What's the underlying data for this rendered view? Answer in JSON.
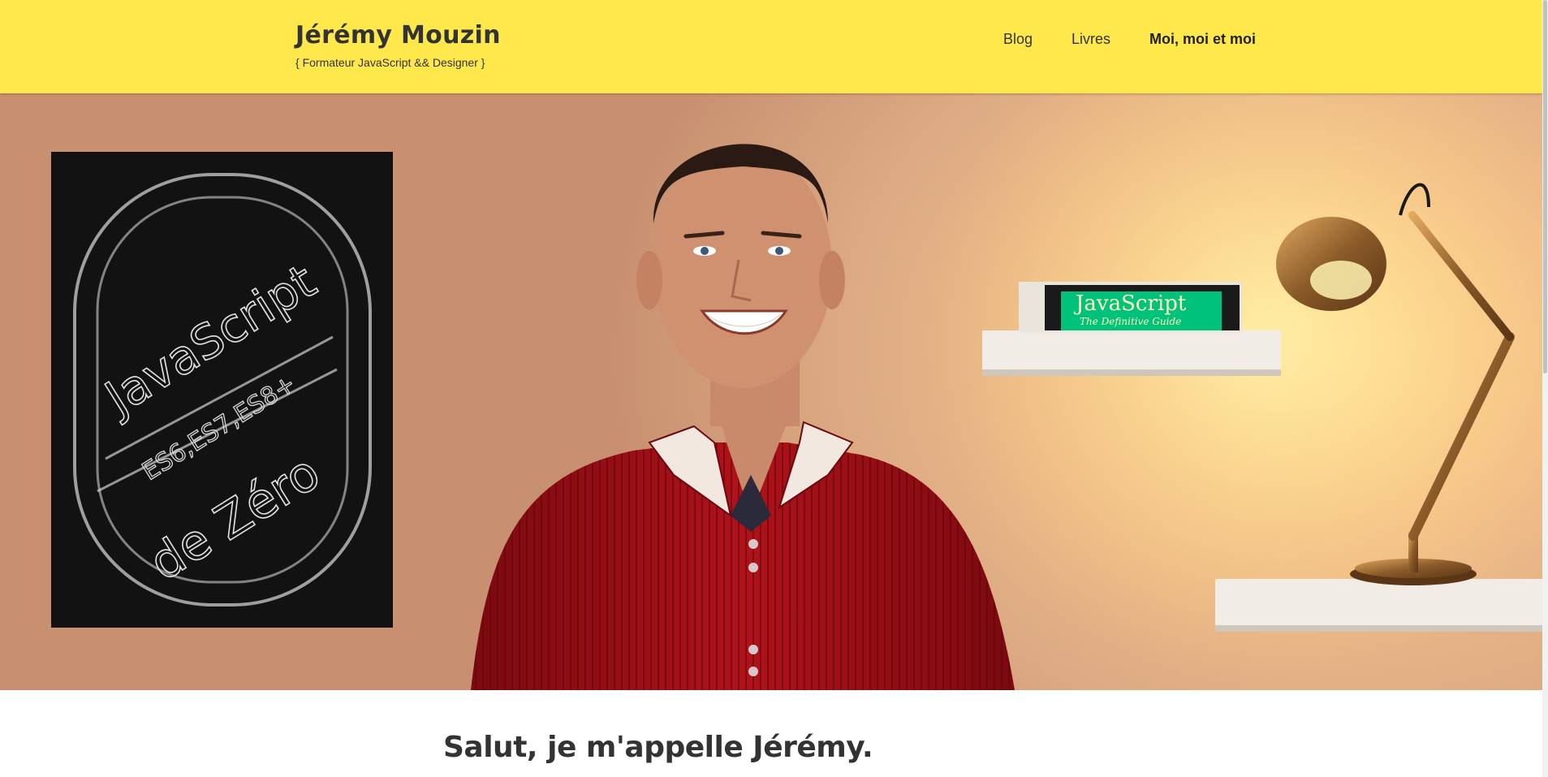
{
  "header": {
    "title": "Jérémy Mouzin",
    "tagline": "{ Formateur JavaScript && Designer }"
  },
  "nav": {
    "items": [
      {
        "label": "Blog"
      },
      {
        "label": "Livres"
      },
      {
        "label": "Moi, moi et moi"
      }
    ],
    "active_index": 2
  },
  "hero": {
    "chalkboard_lines": [
      "JavaScript",
      "ES6,ES7,ES8+",
      "de Zéro"
    ],
    "book_spine": "JavaScript",
    "book_subtitle": "The Definitive Guide"
  },
  "content": {
    "heading": "Salut, je m'appelle Jérémy."
  },
  "colors": {
    "header_bg": "#ffe84c",
    "text": "#333333",
    "shirt": "#a80f16",
    "book": "#00c27a"
  }
}
